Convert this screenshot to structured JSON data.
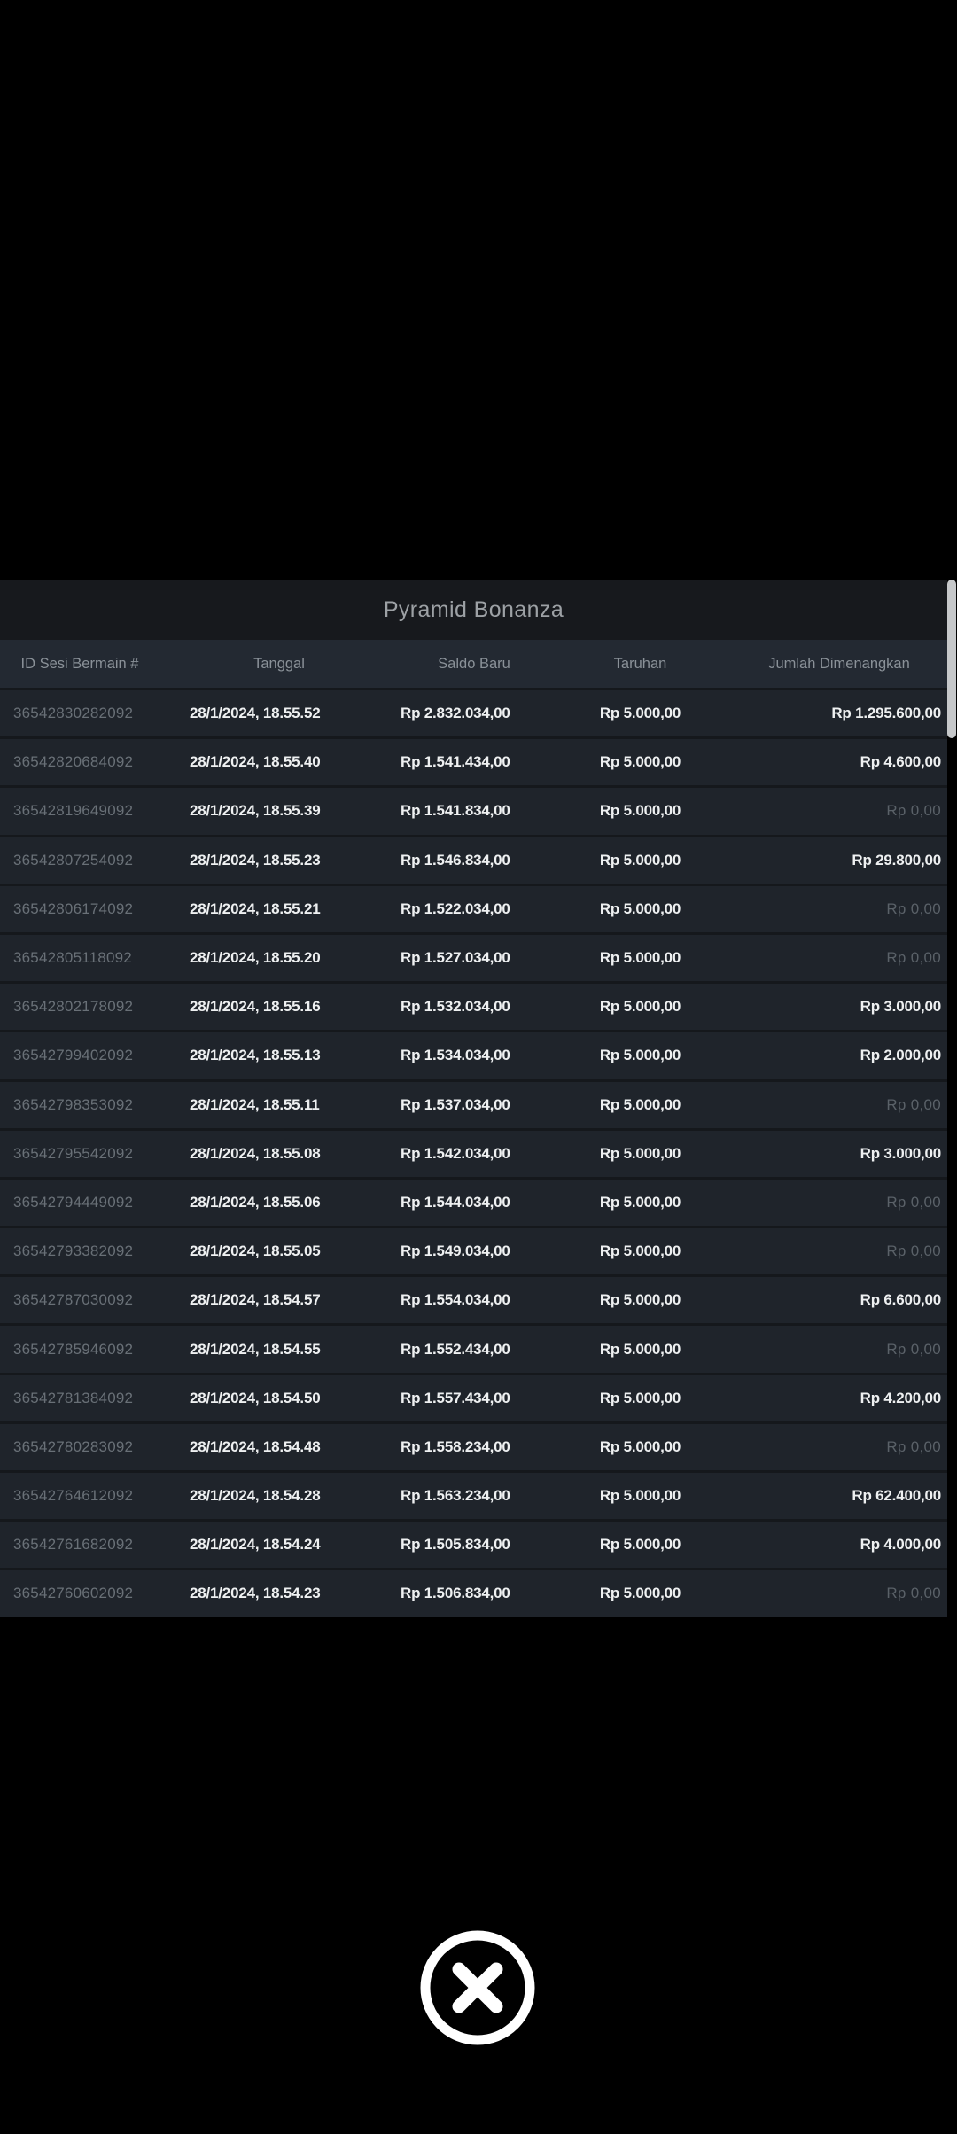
{
  "modal": {
    "title": "Pyramid Bonanza",
    "table": {
      "columns": [
        "ID Sesi Bermain #",
        "Tanggal",
        "Saldo Baru",
        "Taruhan",
        "Jumlah Dimenangkan"
      ],
      "zero_value": "Rp 0,00",
      "rows": [
        {
          "session_id": "36542830282092",
          "date": "28/1/2024, 18.55.52",
          "new_balance": "Rp 2.832.034,00",
          "bet": "Rp 5.000,00",
          "amount_won": "Rp 1.295.600,00"
        },
        {
          "session_id": "36542820684092",
          "date": "28/1/2024, 18.55.40",
          "new_balance": "Rp 1.541.434,00",
          "bet": "Rp 5.000,00",
          "amount_won": "Rp 4.600,00"
        },
        {
          "session_id": "36542819649092",
          "date": "28/1/2024, 18.55.39",
          "new_balance": "Rp 1.541.834,00",
          "bet": "Rp 5.000,00",
          "amount_won": "Rp 0,00"
        },
        {
          "session_id": "36542807254092",
          "date": "28/1/2024, 18.55.23",
          "new_balance": "Rp 1.546.834,00",
          "bet": "Rp 5.000,00",
          "amount_won": "Rp 29.800,00"
        },
        {
          "session_id": "36542806174092",
          "date": "28/1/2024, 18.55.21",
          "new_balance": "Rp 1.522.034,00",
          "bet": "Rp 5.000,00",
          "amount_won": "Rp 0,00"
        },
        {
          "session_id": "36542805118092",
          "date": "28/1/2024, 18.55.20",
          "new_balance": "Rp 1.527.034,00",
          "bet": "Rp 5.000,00",
          "amount_won": "Rp 0,00"
        },
        {
          "session_id": "36542802178092",
          "date": "28/1/2024, 18.55.16",
          "new_balance": "Rp 1.532.034,00",
          "bet": "Rp 5.000,00",
          "amount_won": "Rp 3.000,00"
        },
        {
          "session_id": "36542799402092",
          "date": "28/1/2024, 18.55.13",
          "new_balance": "Rp 1.534.034,00",
          "bet": "Rp 5.000,00",
          "amount_won": "Rp 2.000,00"
        },
        {
          "session_id": "36542798353092",
          "date": "28/1/2024, 18.55.11",
          "new_balance": "Rp 1.537.034,00",
          "bet": "Rp 5.000,00",
          "amount_won": "Rp 0,00"
        },
        {
          "session_id": "36542795542092",
          "date": "28/1/2024, 18.55.08",
          "new_balance": "Rp 1.542.034,00",
          "bet": "Rp 5.000,00",
          "amount_won": "Rp 3.000,00"
        },
        {
          "session_id": "36542794449092",
          "date": "28/1/2024, 18.55.06",
          "new_balance": "Rp 1.544.034,00",
          "bet": "Rp 5.000,00",
          "amount_won": "Rp 0,00"
        },
        {
          "session_id": "36542793382092",
          "date": "28/1/2024, 18.55.05",
          "new_balance": "Rp 1.549.034,00",
          "bet": "Rp 5.000,00",
          "amount_won": "Rp 0,00"
        },
        {
          "session_id": "36542787030092",
          "date": "28/1/2024, 18.54.57",
          "new_balance": "Rp 1.554.034,00",
          "bet": "Rp 5.000,00",
          "amount_won": "Rp 6.600,00"
        },
        {
          "session_id": "36542785946092",
          "date": "28/1/2024, 18.54.55",
          "new_balance": "Rp 1.552.434,00",
          "bet": "Rp 5.000,00",
          "amount_won": "Rp 0,00"
        },
        {
          "session_id": "36542781384092",
          "date": "28/1/2024, 18.54.50",
          "new_balance": "Rp 1.557.434,00",
          "bet": "Rp 5.000,00",
          "amount_won": "Rp 4.200,00"
        },
        {
          "session_id": "36542780283092",
          "date": "28/1/2024, 18.54.48",
          "new_balance": "Rp 1.558.234,00",
          "bet": "Rp 5.000,00",
          "amount_won": "Rp 0,00"
        },
        {
          "session_id": "36542764612092",
          "date": "28/1/2024, 18.54.28",
          "new_balance": "Rp 1.563.234,00",
          "bet": "Rp 5.000,00",
          "amount_won": "Rp 62.400,00"
        },
        {
          "session_id": "36542761682092",
          "date": "28/1/2024, 18.54.24",
          "new_balance": "Rp 1.505.834,00",
          "bet": "Rp 5.000,00",
          "amount_won": "Rp 4.000,00"
        },
        {
          "session_id": "36542760602092",
          "date": "28/1/2024, 18.54.23",
          "new_balance": "Rp 1.506.834,00",
          "bet": "Rp 5.000,00",
          "amount_won": "Rp 0,00"
        }
      ]
    }
  },
  "close_button": {
    "icon": "x-circle-icon"
  },
  "colors": {
    "page_background": "#000000",
    "titlebar_background": "#17191d",
    "header_background": "#232932",
    "row_background": "#1f242b",
    "primary_text": "#eef0f1",
    "muted_text": "#697077",
    "zero_text": "#5a6168",
    "scroll_thumb": "#c6c8ca",
    "close_icon": "#ffffff"
  }
}
